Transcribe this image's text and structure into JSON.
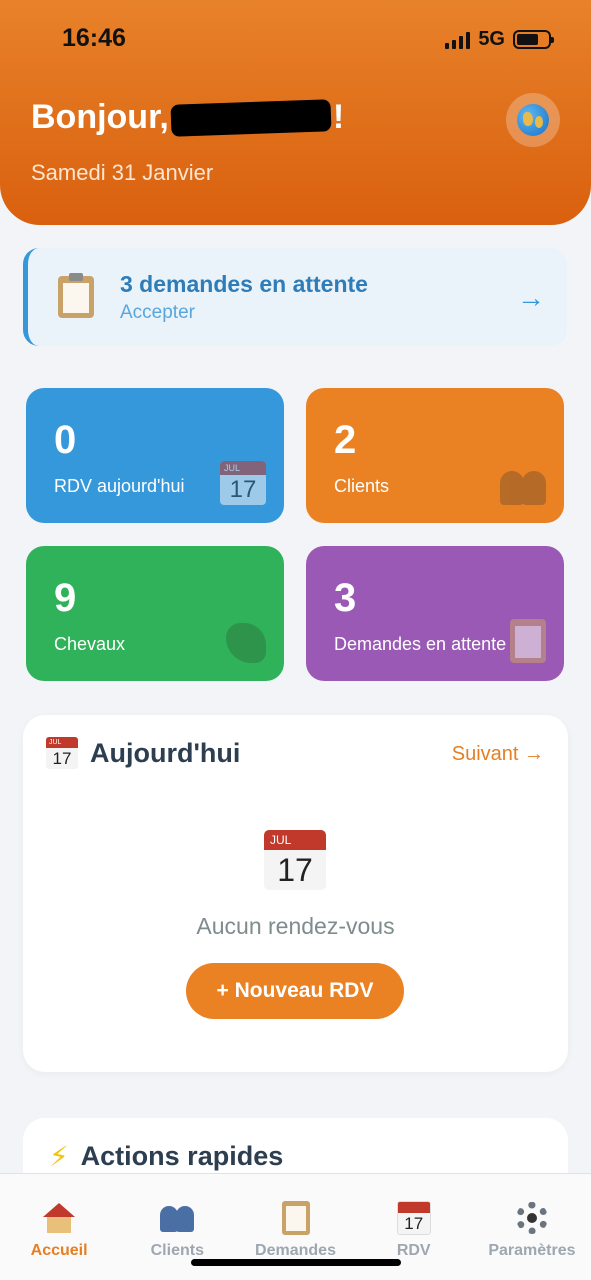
{
  "status_bar": {
    "time": "16:46",
    "network": "5G"
  },
  "header": {
    "greeting_prefix": "Bonjour,",
    "greeting_suffix": "!",
    "date": "Samedi 31 Janvier",
    "globe_icon": "globe-icon"
  },
  "pending_banner": {
    "title": "3 demandes en attente",
    "subtitle": "Accepter",
    "arrow": "→",
    "accent": "#3498db"
  },
  "stats": [
    {
      "value": "0",
      "label": "RDV aujourd'hui",
      "color": "#3498db",
      "icon": "calendar-icon"
    },
    {
      "value": "2",
      "label": "Clients",
      "color": "#ea8223",
      "icon": "people-icon"
    },
    {
      "value": "9",
      "label": "Chevaux",
      "color": "#2fb259",
      "icon": "horse-icon"
    },
    {
      "value": "3",
      "label": "Demandes en attente",
      "color": "#9b59b6",
      "icon": "clipboard-icon"
    }
  ],
  "today": {
    "title": "Aujourd'hui",
    "next_link": "Suivant →",
    "calendar_month": "JUL",
    "calendar_day": "17",
    "empty_text": "Aucun rendez-vous",
    "new_button": "+ Nouveau RDV"
  },
  "quick_actions": {
    "icon": "⚡",
    "title": "Actions rapides"
  },
  "tabs": [
    {
      "label": "Accueil",
      "icon": "house-icon",
      "active": true
    },
    {
      "label": "Clients",
      "icon": "people-icon",
      "active": false
    },
    {
      "label": "Demandes",
      "icon": "clipboard-icon",
      "active": false
    },
    {
      "label": "RDV",
      "icon": "calendar-icon",
      "active": false
    },
    {
      "label": "Paramètres",
      "icon": "gear-icon",
      "active": false
    }
  ],
  "colors": {
    "brand": "#e67e22",
    "header_gradient_top": "#e8822a",
    "header_gradient_bottom": "#d9600e"
  }
}
